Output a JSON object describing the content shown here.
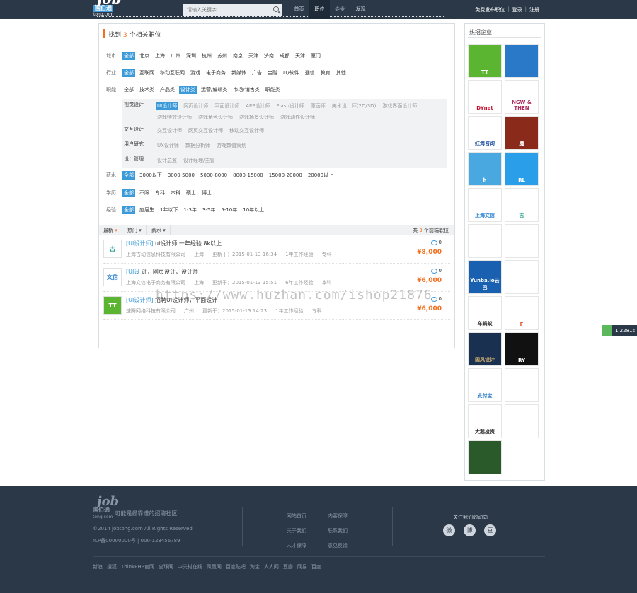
{
  "nav": {
    "logo_job": "job",
    "logo_cn": "国伯通",
    "logo_sub": "tong.com",
    "search_placeholder": "请输入关键字...",
    "links": [
      "首页",
      "职位",
      "企业",
      "发现"
    ],
    "active_index": 1,
    "right": [
      "免费发布职位",
      "登录",
      "注册"
    ]
  },
  "main": {
    "title_pre": "找到",
    "count": "3",
    "title_post": "个相关职位",
    "filters": {
      "city": {
        "label": "城市",
        "options": [
          "全部",
          "北京",
          "上海",
          "广州",
          "深圳",
          "杭州",
          "苏州",
          "南京",
          "天津",
          "济南",
          "成都",
          "天津",
          "厦门"
        ]
      },
      "industry": {
        "label": "行业",
        "options": [
          "全部",
          "互联网",
          "移动互联网",
          "游戏",
          "电子商务",
          "新媒体",
          "广告",
          "金融",
          "IT/软件",
          "通信",
          "教育",
          "其他"
        ]
      },
      "category": {
        "label": "职能",
        "options": [
          "全部",
          "技术类",
          "产品类",
          "设计类",
          "运营/编辑类",
          "市场/销售类",
          "职能类"
        ]
      },
      "salary": {
        "label": "薪水",
        "options": [
          "全部",
          "3000以下",
          "3000-5000",
          "5000-8000",
          "8000-15000",
          "15000-20000",
          "20000以上"
        ]
      },
      "education": {
        "label": "学历",
        "options": [
          "全部",
          "不限",
          "专科",
          "本科",
          "硕士",
          "博士"
        ]
      },
      "experience": {
        "label": "经验",
        "options": [
          "全部",
          "应届生",
          "1年以下",
          "1-3年",
          "3-5年",
          "5-10年",
          "10年以上"
        ]
      }
    },
    "sub": [
      {
        "label": "视觉设计",
        "options": [
          "UI设计师",
          "网页设计师",
          "平面设计师",
          "APP设计师",
          "Flash设计师",
          "原画师",
          "美术设计师(2D/3D)",
          "游戏界面设计师",
          "游戏特效设计师",
          "游戏角色设计师",
          "游戏场景设计师",
          "游戏动作设计师"
        ]
      },
      {
        "label": "交互设计",
        "options": [
          "交互设计师",
          "网页交互设计师",
          "移动交互设计师"
        ]
      },
      {
        "label": "用户研究",
        "options": [
          "UX设计师",
          "数据分析师",
          "游戏数值策划"
        ]
      },
      {
        "label": "设计管理",
        "options": [
          "设计总监",
          "设计经理/主管"
        ]
      }
    ],
    "sort": [
      "最新",
      "热门",
      "薪水"
    ],
    "total_pre": "共",
    "total_num": "3",
    "total_post": "个前端职位",
    "jobs": [
      {
        "tag": "[UI设计师]",
        "title": "ui设计师 一年经验 8k以上",
        "company": "上海古动信息科技有限公司",
        "city": "上海",
        "updated": "更新于：2015-01-13 16:34",
        "exp": "1年工作经验",
        "edu": "专科",
        "comments": "0",
        "salary": "¥8,000"
      },
      {
        "tag": "[UI设",
        "title": "计，网页设计，设计师",
        "company": "上海文信电子商务有限公司",
        "city": "上海",
        "updated": "更新于：2015-01-13 15:51",
        "exp": "6年工作经验",
        "edu": "本科",
        "comments": "0",
        "salary": "¥6,000"
      },
      {
        "tag": "[UI设计师]",
        "title": "招聘UI设计师，平面设计",
        "company": "速腾网络科技有限公司",
        "city": "广州",
        "updated": "更新于：2015-01-13 14:23",
        "exp": "1年工作经验",
        "edu": "专科",
        "comments": "0",
        "salary": "¥6,000"
      }
    ]
  },
  "side": {
    "title": "热招企业",
    "companies": [
      {
        "name": "TT",
        "bg": "#5cb531",
        "fg": "#ffffff"
      },
      {
        "name": "",
        "bg": "#2a78c8",
        "fg": "#ffffff"
      },
      {
        "name": "DYnet",
        "bg": "#ffffff",
        "fg": "#c8102e"
      },
      {
        "name": "NGW & THEN",
        "bg": "#ffffff",
        "fg": "#b03060"
      },
      {
        "name": "红海咨询",
        "bg": "#ffffff",
        "fg": "#1a50a0"
      },
      {
        "name": "魔",
        "bg": "#8a2a1a",
        "fg": "#ffffff"
      },
      {
        "name": "h",
        "bg": "#4aa8e0",
        "fg": "#ffffff"
      },
      {
        "name": "RL",
        "bg": "#2a9ee8",
        "fg": "#ffffff"
      },
      {
        "name": "上海文信",
        "bg": "#ffffff",
        "fg": "#2a80d0"
      },
      {
        "name": "古",
        "bg": "#ffffff",
        "fg": "#2aa090"
      },
      {
        "name": "",
        "bg": "#ffffff",
        "fg": "#e8508a"
      },
      {
        "name": "",
        "bg": "#ffffff",
        "fg": "#222222"
      },
      {
        "name": "Yunba.io云巴",
        "bg": "#1a60b0",
        "fg": "#ffffff"
      },
      {
        "name": "",
        "bg": "#ffffff",
        "fg": "#e03030"
      },
      {
        "name": "车蚂蚁",
        "bg": "#ffffff",
        "fg": "#333333"
      },
      {
        "name": "F",
        "bg": "#ffffff",
        "fg": "#e05020"
      },
      {
        "name": "国风设计",
        "bg": "#1a3050",
        "fg": "#d0b070"
      },
      {
        "name": "RY",
        "bg": "#111111",
        "fg": "#ffffff"
      },
      {
        "name": "支付宝",
        "bg": "#ffffff",
        "fg": "#1a70c0"
      },
      {
        "name": "",
        "bg": "#ffffff",
        "fg": "#9ac030"
      },
      {
        "name": "大鹅投资",
        "bg": "#ffffff",
        "fg": "#333333"
      },
      {
        "name": "",
        "bg": "#ffffff",
        "fg": "#1a80d0"
      },
      {
        "name": "",
        "bg": "#2a5a2a",
        "fg": "#e070a0"
      }
    ]
  },
  "badge": "1.2281s",
  "watermark": "https://www.huzhan.com/ishop21876",
  "footer": {
    "slogan": "可能是最靠谱的招聘社区",
    "copy": "©2014 jobtong.com All Rights Reserved",
    "icp": "ICP备00000000号 | 000-123456789",
    "links": [
      "网站首页",
      "内容保障",
      "关于我们",
      "联系我们",
      "人才保障",
      "意见反馈"
    ],
    "follow": "关注我们的动向",
    "social": [
      "微",
      "博",
      "豆"
    ],
    "partners": [
      "新浪",
      "搜狐",
      "ThinkPHP官网",
      "全球网",
      "中关村在线",
      "凤凰网",
      "百度贴吧",
      "淘宝",
      "人人网",
      "豆瓣",
      "网易",
      "百度"
    ]
  }
}
